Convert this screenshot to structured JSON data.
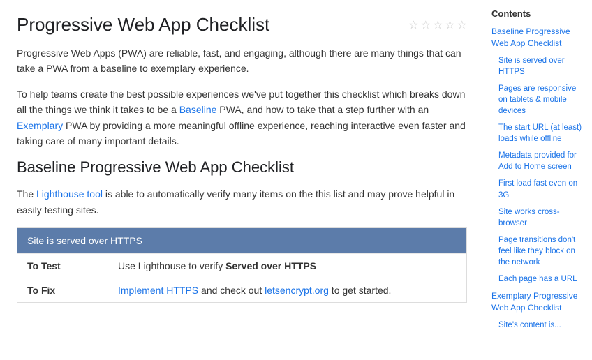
{
  "pageTitle": "Progressive Web App Checklist",
  "stars": [
    "☆",
    "☆",
    "☆",
    "☆",
    "☆"
  ],
  "intro1": "Progressive Web Apps (PWA) are reliable, fast, and engaging, although there are many things that can take a PWA from a baseline to exemplary experience.",
  "intro1_link_text": "although there are many things",
  "intro2_before": "To help teams create the best possible experiences we've put together this checklist which breaks down all the things we think it takes to be a ",
  "intro2_baseline": "Baseline",
  "intro2_mid": " PWA, and how to take that a step further with an ",
  "intro2_exemplary": "Exemplary",
  "intro2_after": " PWA by providing a more meaningful offline experience, reaching interactive even faster and taking care of many important details.",
  "sectionHeading": "Baseline Progressive Web App Checklist",
  "sectionPara_before": "The ",
  "lighthouseLink": "Lighthouse tool",
  "sectionPara_after": " is able to automatically verify many items on the this list and may prove helpful in easily testing sites.",
  "tableHeader": "Site is served over HTTPS",
  "tableRows": [
    {
      "label": "To Test",
      "value": "Use Lighthouse to verify ",
      "bold": "Served over HTTPS"
    },
    {
      "label": "To Fix",
      "value_before": "",
      "link1": "Implement HTTPS",
      "value_mid": " and check out ",
      "link2": "letsencrypt.org",
      "value_after": " to get started."
    }
  ],
  "sidebar": {
    "title": "Contents",
    "items": [
      {
        "text": "Baseline Progressive Web App Checklist",
        "level": "top"
      },
      {
        "text": "Site is served over HTTPS",
        "level": "sub"
      },
      {
        "text": "Pages are responsive on tablets & mobile devices",
        "level": "sub"
      },
      {
        "text": "The start URL (at least) loads while offline",
        "level": "sub"
      },
      {
        "text": "Metadata provided for Add to Home screen",
        "level": "sub"
      },
      {
        "text": "First load fast even on 3G",
        "level": "sub"
      },
      {
        "text": "Site works cross-browser",
        "level": "sub"
      },
      {
        "text": "Page transitions don't feel like they block on the network",
        "level": "sub"
      },
      {
        "text": "Each page has a URL",
        "level": "sub"
      },
      {
        "text": "Exemplary Progressive Web App Checklist",
        "level": "top"
      },
      {
        "text": "Site's content is...",
        "level": "sub"
      }
    ]
  }
}
